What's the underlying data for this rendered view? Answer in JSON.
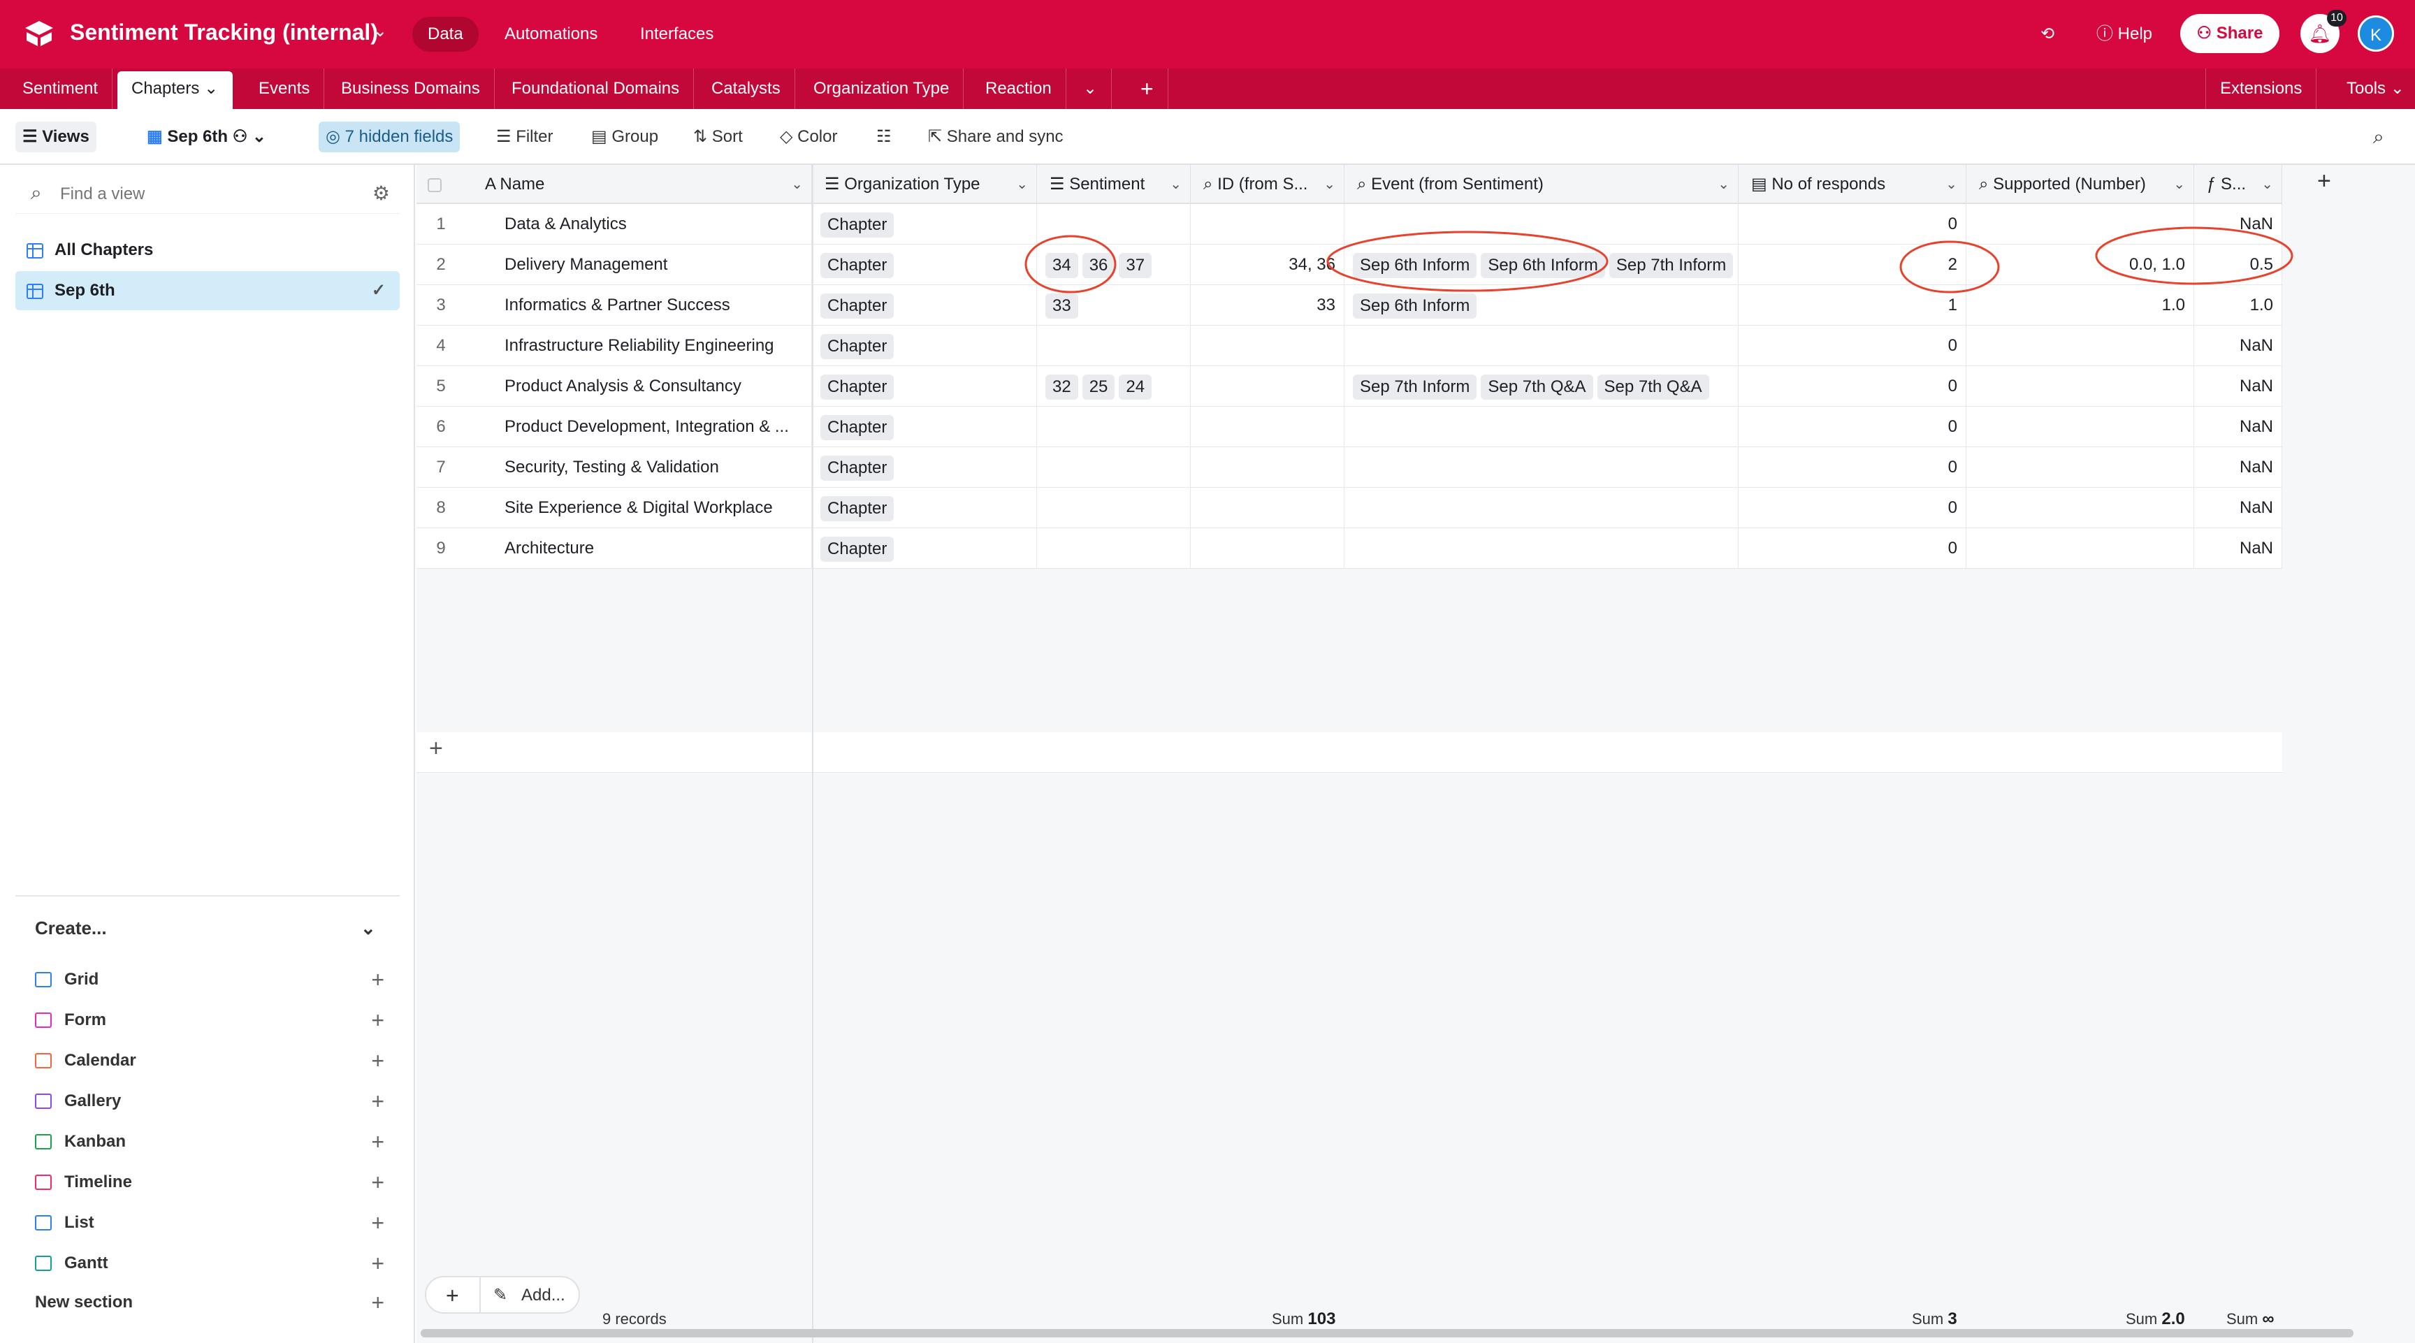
{
  "app": {
    "title": "Sentiment Tracking (internal)",
    "nav": [
      "Data",
      "Automations",
      "Interfaces"
    ],
    "help": "Help",
    "share": "Share",
    "notifications": "10",
    "avatar": "K"
  },
  "tabs": [
    "Sentiment",
    "Chapters",
    "Events",
    "Business Domains",
    "Foundational Domains",
    "Catalysts",
    "Organization Type",
    "Reaction"
  ],
  "tabs_right": [
    "Extensions",
    "Tools"
  ],
  "toolbar": {
    "views": "Views",
    "view_name": "Sep 6th",
    "hidden": "7 hidden fields",
    "filter": "Filter",
    "group": "Group",
    "sort": "Sort",
    "color": "Color",
    "share_sync": "Share and sync"
  },
  "sidebar": {
    "find_placeholder": "Find a view",
    "views": [
      "All Chapters",
      "Sep 6th"
    ],
    "create": "Create...",
    "create_items": [
      {
        "label": "Grid",
        "color": "#2d7ff9"
      },
      {
        "label": "Form",
        "color": "#e929ba"
      },
      {
        "label": "Calendar",
        "color": "#f7653b"
      },
      {
        "label": "Gallery",
        "color": "#8b46ff"
      },
      {
        "label": "Kanban",
        "color": "#20a047"
      },
      {
        "label": "Timeline",
        "color": "#f82b60"
      },
      {
        "label": "List",
        "color": "#2d7ff9"
      },
      {
        "label": "Gantt",
        "color": "#11a09a"
      }
    ],
    "new_section": "New section"
  },
  "columns": [
    "Name",
    "Organization Type",
    "Sentiment",
    "ID (from S...",
    "Event (from Sentiment)",
    "No of responds",
    "Supported (Number)",
    "S..."
  ],
  "rows": [
    {
      "n": "1",
      "name": "Data & Analytics",
      "org": "Chapter",
      "sent": [],
      "id": "",
      "events": [],
      "responds": "0",
      "supported": "",
      "s": "NaN"
    },
    {
      "n": "2",
      "name": "Delivery Management",
      "org": "Chapter",
      "sent": [
        "34",
        "36",
        "37"
      ],
      "id": "34, 36",
      "events": [
        "Sep 6th Inform",
        "Sep 6th Inform",
        "Sep 7th Inform"
      ],
      "responds": "2",
      "supported": "0.0, 1.0",
      "s": "0.5"
    },
    {
      "n": "3",
      "name": "Informatics & Partner Success",
      "org": "Chapter",
      "sent": [
        "33"
      ],
      "id": "33",
      "events": [
        "Sep 6th Inform"
      ],
      "responds": "1",
      "supported": "1.0",
      "s": "1.0"
    },
    {
      "n": "4",
      "name": "Infrastructure Reliability Engineering",
      "org": "Chapter",
      "sent": [],
      "id": "",
      "events": [],
      "responds": "0",
      "supported": "",
      "s": "NaN"
    },
    {
      "n": "5",
      "name": "Product Analysis & Consultancy",
      "org": "Chapter",
      "sent": [
        "32",
        "25",
        "24"
      ],
      "id": "",
      "events": [
        "Sep 7th Inform",
        "Sep 7th Q&A",
        "Sep 7th Q&A"
      ],
      "responds": "0",
      "supported": "",
      "s": "NaN"
    },
    {
      "n": "6",
      "name": "Product Development, Integration & ...",
      "org": "Chapter",
      "sent": [],
      "id": "",
      "events": [],
      "responds": "0",
      "supported": "",
      "s": "NaN"
    },
    {
      "n": "7",
      "name": "Security, Testing & Validation",
      "org": "Chapter",
      "sent": [],
      "id": "",
      "events": [],
      "responds": "0",
      "supported": "",
      "s": "NaN"
    },
    {
      "n": "8",
      "name": "Site Experience & Digital Workplace",
      "org": "Chapter",
      "sent": [],
      "id": "",
      "events": [],
      "responds": "0",
      "supported": "",
      "s": "NaN"
    },
    {
      "n": "9",
      "name": "Architecture",
      "org": "Chapter",
      "sent": [],
      "id": "",
      "events": [],
      "responds": "0",
      "supported": "",
      "s": "NaN"
    }
  ],
  "footer": {
    "add": "Add...",
    "records": "9 records",
    "sum_label": "Sum",
    "sum_id": "103",
    "sum_responds": "3",
    "sum_supported": "2.0",
    "sum_s": "∞"
  },
  "colors": {
    "brand": "#d7083f",
    "tabbar": "#c20739",
    "annotation": "#e8412c"
  }
}
